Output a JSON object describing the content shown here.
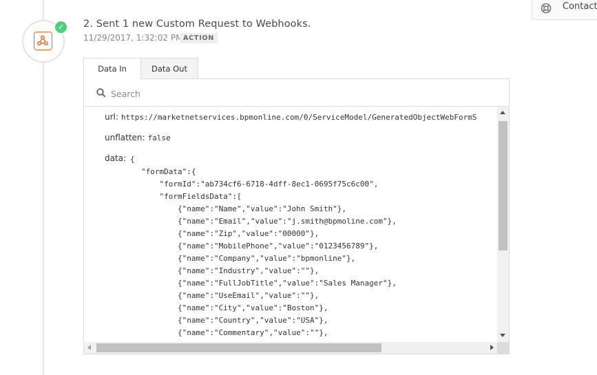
{
  "header": {
    "contact_label": "Contact"
  },
  "step": {
    "title": "2. Sent 1 new Custom Request to Webhooks.",
    "timestamp": "11/29/2017, 1:32:02 PM",
    "badge": "ACTION",
    "app_icon": "webhooks-icon",
    "status_icon": "check-icon",
    "status_color": "#4fcf7e",
    "app_color": "#e76a2b"
  },
  "tabs": [
    {
      "label": "Data In",
      "active": true
    },
    {
      "label": "Data Out",
      "active": false
    }
  ],
  "search": {
    "placeholder": "Search"
  },
  "fields": {
    "url_key": "url:",
    "url_value": "https://marketnetservices.bpmonline.com/0/ServiceModel/GeneratedObjectWebFormS",
    "unflatten_key": "unflatten:",
    "unflatten_value": "false",
    "data_key": "data:",
    "data_lines": [
      "{",
      "        \"formData\":{",
      "            \"formId\":\"ab734cf6-6718-4dff-8ec1-0695f75c6c00\",",
      "            \"formFieldsData\":[",
      "                {\"name\":\"Name\",\"value\":\"John Smith\"},",
      "                {\"name\":\"Email\",\"value\":\"j.smith@bpmoline.com\"},",
      "                {\"name\":\"Zip\",\"value\":\"00000\"},",
      "                {\"name\":\"MobilePhone\",\"value\":\"0123456789\"},",
      "                {\"name\":\"Company\",\"value\":\"bpmonline\"},",
      "                {\"name\":\"Industry\",\"value\":\"\"},",
      "                {\"name\":\"FullJobTitle\",\"value\":\"Sales Manager\"},",
      "                {\"name\":\"UseEmail\",\"value\":\"\"},",
      "                {\"name\":\"City\",\"value\":\"Boston\"},",
      "                {\"name\":\"Country\",\"value\":\"USA\"},",
      "                {\"name\":\"Commentary\",\"value\":\"\"},"
    ]
  }
}
